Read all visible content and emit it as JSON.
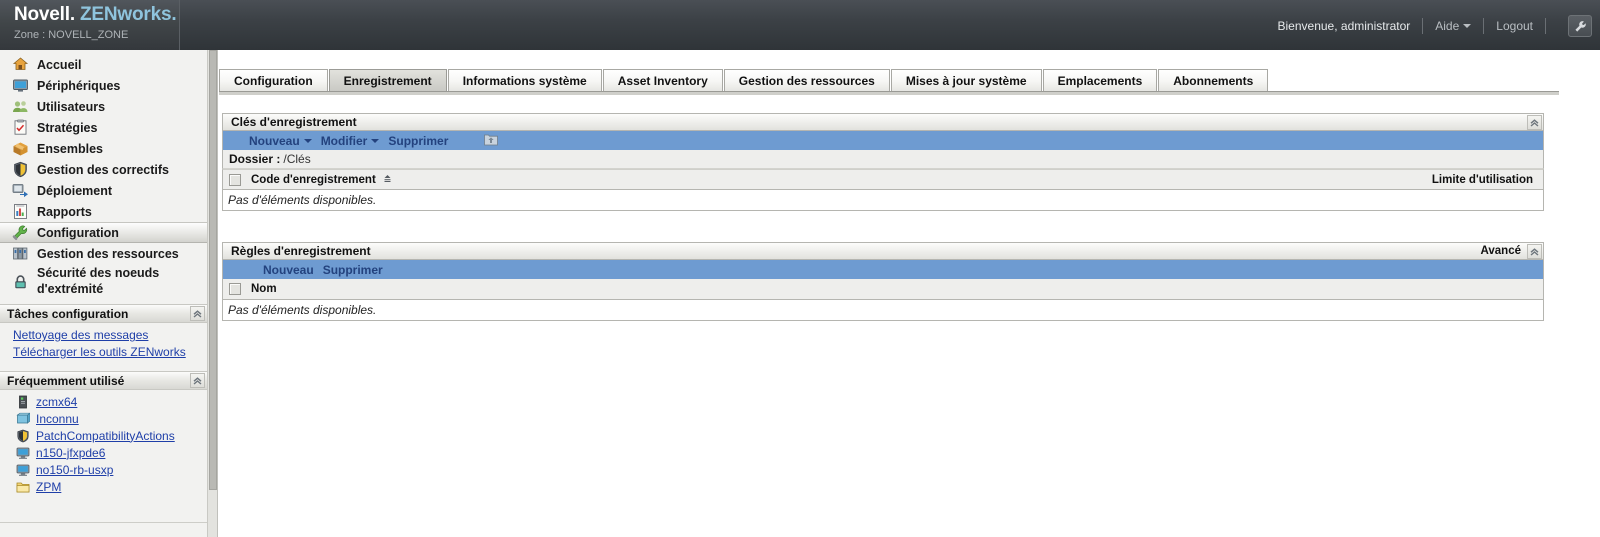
{
  "header": {
    "brand_novell": "Novell",
    "brand_dot": ".",
    "brand_zen": "ZEN",
    "brand_works": "works",
    "brand_works_dot": ".",
    "zone": "Zone : NOVELL_ZONE",
    "welcome": "Bienvenue, administrator",
    "help": "Aide",
    "logout": "Logout",
    "tool_icon": "wrench-icon"
  },
  "sidebar": {
    "items": [
      {
        "label": "Accueil",
        "icon": "home-icon",
        "active": false
      },
      {
        "label": "Périphériques",
        "icon": "monitor-icon",
        "active": false
      },
      {
        "label": "Utilisateurs",
        "icon": "users-icon",
        "active": false
      },
      {
        "label": "Stratégies",
        "icon": "policy-icon",
        "active": false
      },
      {
        "label": "Ensembles",
        "icon": "bundle-box-icon",
        "active": false
      },
      {
        "label": "Gestion des correctifs",
        "icon": "shield-icon",
        "active": false
      },
      {
        "label": "Déploiement",
        "icon": "deploy-icon",
        "active": false
      },
      {
        "label": "Rapports",
        "icon": "report-chart-icon",
        "active": false
      },
      {
        "label": "Configuration",
        "icon": "wrench-icon",
        "active": true
      },
      {
        "label": "Gestion des ressources",
        "icon": "asset-books-icon",
        "active": false
      },
      {
        "label": "Sécurité des noeuds d'extrémité",
        "icon": "lock-icon",
        "active": false
      }
    ],
    "tasks_panel": {
      "title": "Tâches configuration",
      "links": [
        "Nettoyage des messages",
        "Télécharger les outils ZENworks"
      ]
    },
    "frequent_panel": {
      "title": "Fréquemment utilisé",
      "items": [
        {
          "label": "zcmx64",
          "icon": "server-icon"
        },
        {
          "label": "Inconnu",
          "icon": "unknown-device-icon"
        },
        {
          "label": "PatchCompatibilityActions",
          "icon": "shield-icon"
        },
        {
          "label": "n150-jfxpde6",
          "icon": "workstation-icon"
        },
        {
          "label": "no150-rb-usxp",
          "icon": "workstation-icon"
        },
        {
          "label": "ZPM",
          "icon": "folder-icon"
        }
      ]
    }
  },
  "tabs": [
    {
      "label": "Configuration",
      "active": false
    },
    {
      "label": "Enregistrement",
      "active": true
    },
    {
      "label": "Informations système",
      "active": false
    },
    {
      "label": "Asset Inventory",
      "active": false
    },
    {
      "label": "Gestion des ressources",
      "active": false
    },
    {
      "label": "Mises à jour système",
      "active": false
    },
    {
      "label": "Emplacements",
      "active": false
    },
    {
      "label": "Abonnements",
      "active": false
    }
  ],
  "keys_panel": {
    "title": "Clés d'enregistrement",
    "collapse_icon": "chevron-up-double-icon",
    "toolbar": {
      "up_icon": "folder-up-icon",
      "new": "Nouveau",
      "edit": "Modifier",
      "delete": "Supprimer"
    },
    "folder_label": "Dossier :",
    "folder_value": "/Clés",
    "columns": {
      "name": "Code d'enregistrement",
      "sort_icon": "sort-asc-icon",
      "usage_limit": "Limite d'utilisation"
    },
    "empty_text": "Pas d'éléments disponibles."
  },
  "rules_panel": {
    "title": "Règles d'enregistrement",
    "advanced": "Avancé",
    "collapse_icon": "chevron-up-double-icon",
    "toolbar": {
      "new": "Nouveau",
      "delete": "Supprimer"
    },
    "columns": {
      "name": "Nom"
    },
    "empty_text": "Pas d'éléments disponibles."
  },
  "colors": {
    "toolbar_blue": "#6e9bd1",
    "link_blue": "#1f3fa8",
    "brand_accent": "#8fc4dd",
    "header_dark": "#3c4146"
  }
}
